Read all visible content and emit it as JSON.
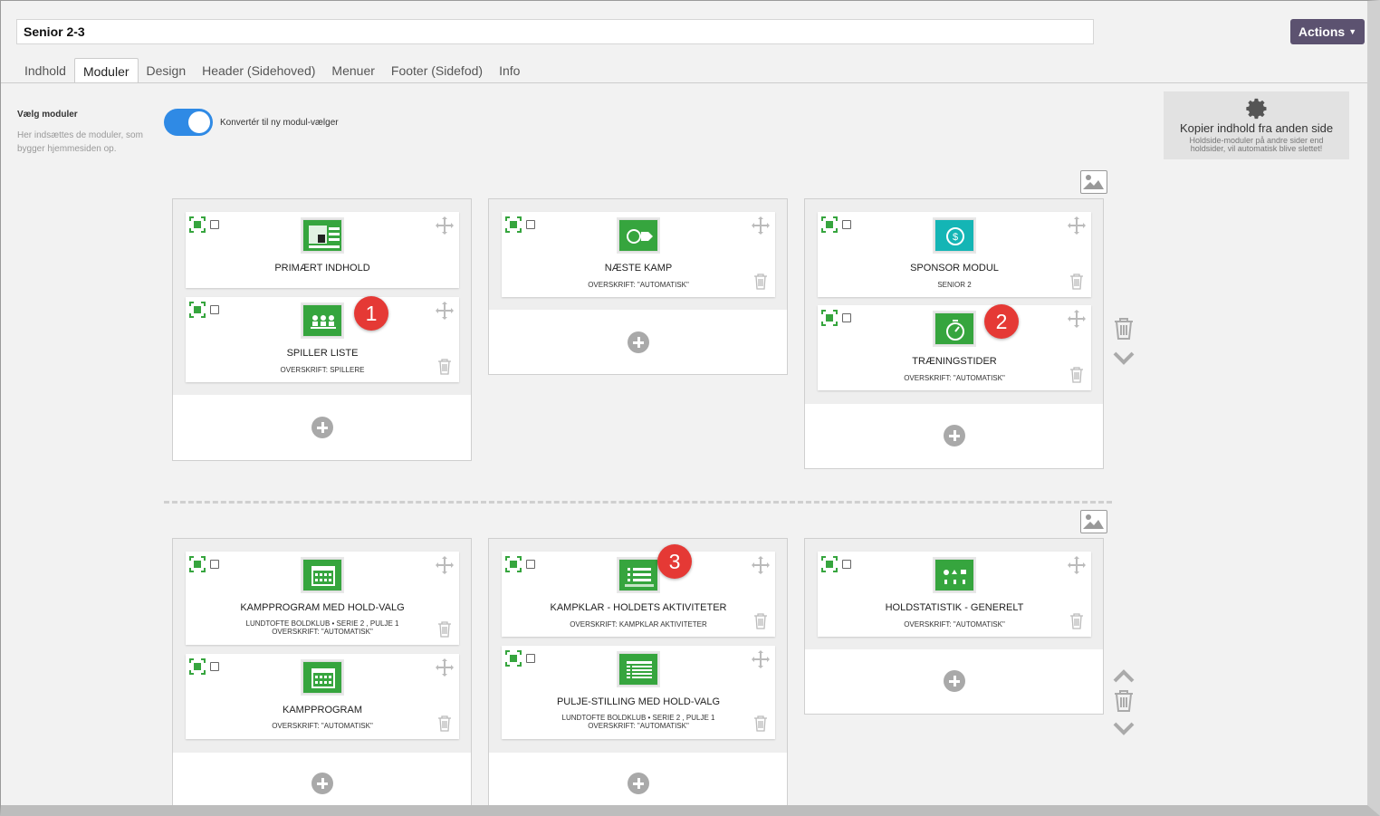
{
  "page": {
    "title_value": "Senior 2-3",
    "actions_label": "Actions"
  },
  "tabs": [
    {
      "label": "Indhold"
    },
    {
      "label": "Moduler"
    },
    {
      "label": "Design"
    },
    {
      "label": "Header (Sidehoved)"
    },
    {
      "label": "Menuer"
    },
    {
      "label": "Footer (Sidefod)"
    },
    {
      "label": "Info"
    }
  ],
  "left_panel": {
    "label": "Vælg moduler",
    "description": "Her indsættes de moduler, som bygger hjemmesiden op.",
    "toggle_label": "Konvertér til ny modul-vælger",
    "toggle_on": true
  },
  "copy_box": {
    "title": "Kopier indhold fra anden side",
    "subtitle": "Holdside-moduler på andre sider end holdsider, vil automatisk blive slettet!"
  },
  "rows": [
    {
      "columns": [
        {
          "cards": [
            {
              "name": "PRIMÆRT INDHOLD",
              "sub1": "",
              "sub2": "",
              "icon": "primary-content-icon"
            },
            {
              "name": "SPILLER LISTE",
              "sub1": "OVERSKRIFT: SPILLERE",
              "sub2": "",
              "icon": "player-list-icon"
            }
          ]
        },
        {
          "cards": [
            {
              "name": "NÆSTE KAMP",
              "sub1": "OVERSKRIFT: \"AUTOMATISK\"",
              "sub2": "",
              "icon": "next-match-icon"
            }
          ]
        },
        {
          "cards": [
            {
              "name": "SPONSOR MODUL",
              "sub1": "SENIOR 2",
              "sub2": "",
              "icon": "sponsor-icon"
            },
            {
              "name": "TRÆNINGSTIDER",
              "sub1": "OVERSKRIFT: \"AUTOMATISK\"",
              "sub2": "",
              "icon": "stopwatch-icon"
            }
          ]
        }
      ]
    },
    {
      "columns": [
        {
          "cards": [
            {
              "name": "KAMPPROGRAM MED HOLD-VALG",
              "sub1": "LUNDTOFTE BOLDKLUB • SERIE 2 , PULJE 1",
              "sub2": "OVERSKRIFT: \"AUTOMATISK\"",
              "icon": "calendar-icon"
            },
            {
              "name": "KAMPPROGRAM",
              "sub1": "OVERSKRIFT: \"AUTOMATISK\"",
              "sub2": "",
              "icon": "calendar-icon"
            }
          ]
        },
        {
          "cards": [
            {
              "name": "KAMPKLAR - HOLDETS AKTIVITETER",
              "sub1": "OVERSKRIFT: KAMPKLAR AKTIVITETER",
              "sub2": "",
              "icon": "activity-list-icon"
            },
            {
              "name": "PULJE-STILLING MED HOLD-VALG",
              "sub1": "LUNDTOFTE BOLDKLUB • SERIE 2 , PULJE 1",
              "sub2": "OVERSKRIFT: \"AUTOMATISK\"",
              "icon": "standings-table-icon"
            }
          ]
        },
        {
          "cards": [
            {
              "name": "HOLDSTATISTIK - GENERELT",
              "sub1": "OVERSKRIFT: \"AUTOMATISK\"",
              "sub2": "",
              "icon": "team-stats-icon"
            }
          ]
        }
      ]
    }
  ],
  "badges": [
    "1",
    "2",
    "3"
  ],
  "colors": {
    "accent_green": "#36a53e",
    "teal": "#14b5b5",
    "toggle_blue": "#2f8ae5",
    "actions_purple": "#5c5270",
    "badge_red": "#e53935"
  }
}
